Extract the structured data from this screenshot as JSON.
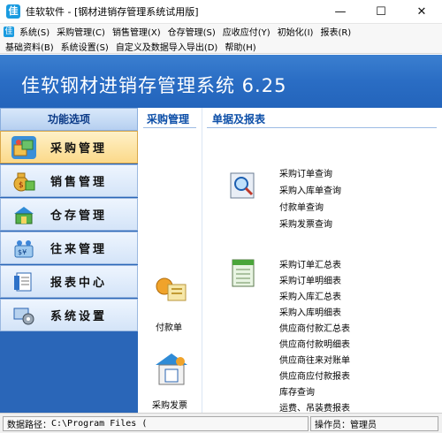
{
  "window": {
    "title": "佳软软件 - [钢材进销存管理系统试用版]",
    "app_icon": "app-logo-icon",
    "controls": [
      "—",
      "☐",
      "✕"
    ]
  },
  "menu_row1": [
    "系统(S)",
    "采购管理(C)",
    "销售管理(X)",
    "仓存管理(S)",
    "应收应付(Y)",
    "初始化(I)",
    "报表(R)"
  ],
  "menu_row2": [
    "基础资料(B)",
    "系统设置(S)",
    "自定义及数据导入导出(D)",
    "帮助(H)"
  ],
  "banner": {
    "title": "佳软钢材进销存管理系统  6.25"
  },
  "nav": {
    "header": "功能选项",
    "items": [
      {
        "label": "采购管理",
        "icon": "purchase-icon",
        "active": true
      },
      {
        "label": "销售管理",
        "icon": "money-bag-icon",
        "active": false
      },
      {
        "label": "仓存管理",
        "icon": "warehouse-icon",
        "active": false
      },
      {
        "label": "往来管理",
        "icon": "exchange-icon",
        "active": false
      },
      {
        "label": "报表中心",
        "icon": "report-icon",
        "active": false
      },
      {
        "label": "系统设置",
        "icon": "settings-icon",
        "active": false
      }
    ]
  },
  "content": {
    "tab_left": "采购管理",
    "tab_right": "单据及报表",
    "shortcut1": "付款单",
    "shortcut2": "采购发票",
    "query_links": [
      "采购订单查询",
      "采购入库单查询",
      "付款单查询",
      "采购发票查询"
    ],
    "report_links": [
      "采购订单汇总表",
      "采购订单明细表",
      "采购入库汇总表",
      "采购入库明细表",
      "供应商付款汇总表",
      "供应商付款明细表",
      "供应商往来对账单",
      "供应商应付款报表",
      "库存查询",
      "运费、吊装费报表"
    ]
  },
  "status": {
    "path_label": "数据路径：",
    "path_value": "C:\\Program Files (",
    "operator_label": "操作员：",
    "operator_value": "管理员"
  },
  "colors": {
    "banner": "#2a6dc4",
    "nav_bg": "#2a66b8",
    "active_item": "#fbd98a",
    "tab_text": "#0d4fa8"
  }
}
